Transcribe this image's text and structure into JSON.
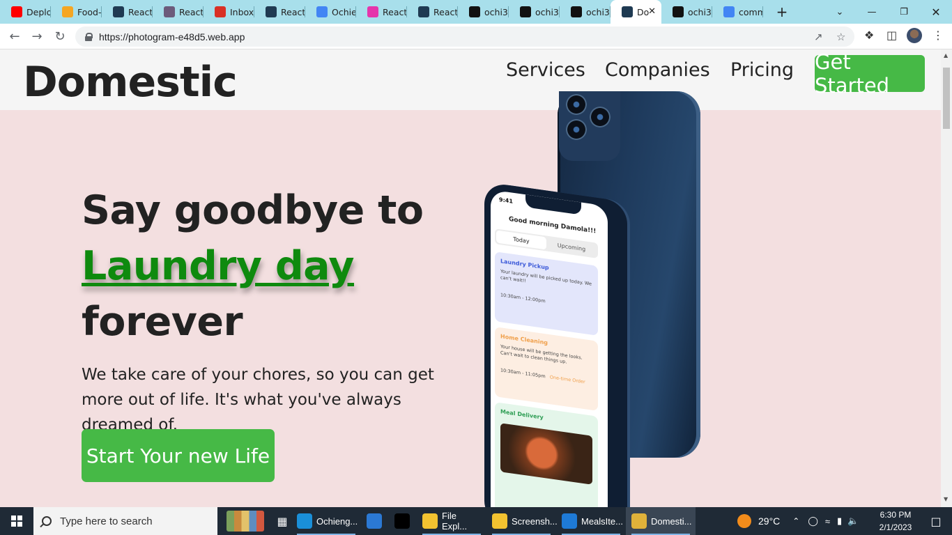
{
  "browser": {
    "tabs": [
      {
        "title": "Deplo",
        "icon": "youtube-icon",
        "color": "#ff0000"
      },
      {
        "title": "Food-",
        "icon": "firebase-icon",
        "color": "#f5a623"
      },
      {
        "title": "React",
        "icon": "react-icon",
        "color": "#1f3a52"
      },
      {
        "title": "React",
        "icon": "owl-icon",
        "color": "#6c5b7b"
      },
      {
        "title": "Inbox",
        "icon": "gmail-icon",
        "color": "#d93025"
      },
      {
        "title": "React",
        "icon": "react-icon",
        "color": "#1f3a52"
      },
      {
        "title": "Ochie",
        "icon": "docs-icon",
        "color": "#4285f4"
      },
      {
        "title": "React",
        "icon": "graphql-icon",
        "color": "#e535ab"
      },
      {
        "title": "React",
        "icon": "react-icon",
        "color": "#1f3a52"
      },
      {
        "title": "ochi3",
        "icon": "github-icon",
        "color": "#111111"
      },
      {
        "title": "ochi3",
        "icon": "github-icon",
        "color": "#111111"
      },
      {
        "title": "ochi3",
        "icon": "github-icon",
        "color": "#111111"
      },
      {
        "title": "Do",
        "icon": "react-icon",
        "color": "#1f3a52",
        "active": true
      },
      {
        "title": "ochi3",
        "icon": "github-icon",
        "color": "#111111"
      },
      {
        "title": "comm",
        "icon": "google-icon",
        "color": "#4285f4"
      }
    ],
    "url": "https://photogram-e48d5.web.app"
  },
  "site": {
    "logo": "Domestic",
    "nav": [
      "Services",
      "Companies",
      "Pricing"
    ],
    "cta_top": "Get Started",
    "hero": {
      "line1": "Say goodbye to",
      "highlight": "Laundry day",
      "line3": "forever",
      "subtitle": "We take care of your chores, so you can get more out of life. It's what you've always dreamed of.",
      "cta": "Start Your new Life"
    },
    "phone": {
      "time": "9:41",
      "greeting": "Good morning Damola!!!",
      "tabs": [
        "Today",
        "Upcoming"
      ],
      "cards": [
        {
          "title": "Laundry Pickup",
          "text": "Your laundry will be picked up today. We can't wait!!",
          "time": "10:30am - 12:00pm",
          "color": "#e3e6fb",
          "title_color": "#3d5bd9"
        },
        {
          "title": "Home Cleaning",
          "text": "Your house will be getting the looks. Can't wait to clean things up.",
          "time": "10:30am - 11:05pm",
          "extra": "One-time Order",
          "color": "#fdeee2",
          "title_color": "#f0a04b"
        },
        {
          "title": "Meal Delivery",
          "text": "",
          "time": "",
          "color": "#e4f6ea",
          "title_color": "#2f9e55"
        }
      ]
    }
  },
  "taskbar": {
    "search_placeholder": "Type here to search",
    "apps": [
      {
        "label": "Ochieng...",
        "icon": "edge-icon",
        "color": "#1a8fd8",
        "open": true
      },
      {
        "label": "",
        "icon": "mail-icon",
        "color": "#2b79d4"
      },
      {
        "label": "",
        "icon": "tiktok-icon",
        "color": "#000000"
      },
      {
        "label": "File Expl...",
        "icon": "folder-icon",
        "color": "#f2c230",
        "open": true
      },
      {
        "label": "Screensh...",
        "icon": "folder-icon",
        "color": "#f2c230",
        "open": true
      },
      {
        "label": "MealsIte...",
        "icon": "vscode-icon",
        "color": "#1e7ad6",
        "open": true
      },
      {
        "label": "Domesti...",
        "icon": "chrome-icon",
        "color": "#e0b23a",
        "open": true,
        "current": true
      }
    ],
    "weather": "29°C",
    "time": "6:30 PM",
    "date": "2/1/2023"
  }
}
